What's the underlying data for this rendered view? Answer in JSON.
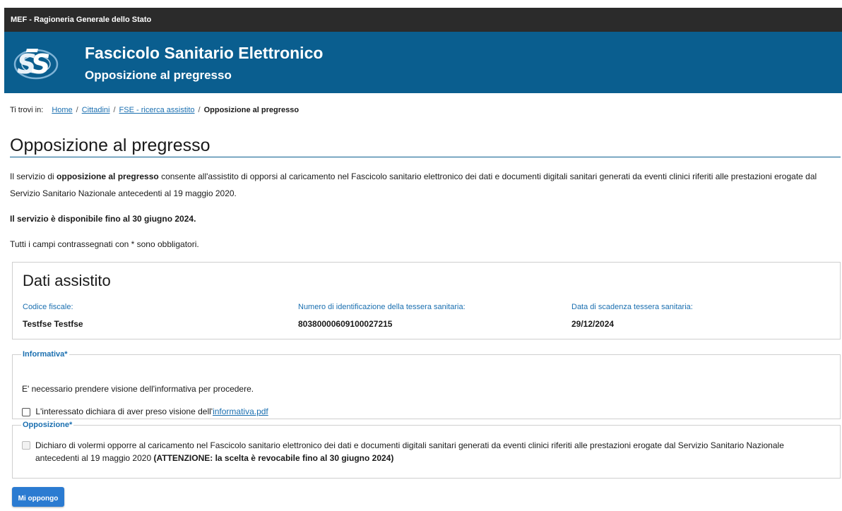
{
  "topbar": {
    "text": "MEF - Ragioneria Generale dello Stato"
  },
  "header": {
    "logo_text": "STS",
    "title": "Fascicolo Sanitario Elettronico",
    "subtitle": "Opposizione al pregresso"
  },
  "breadcrumb": {
    "label": "Ti trovi in:",
    "items": [
      "Home",
      "Cittadini",
      "FSE - ricerca assistito"
    ],
    "separator": "/",
    "current": "Opposizione al pregresso"
  },
  "page": {
    "title": "Opposizione al pregresso",
    "intro_before": "Il servizio di ",
    "intro_bold": "opposizione al pregresso",
    "intro_after": " consente all'assistito di opporsi al caricamento nel Fascicolo sanitario elettronico dei dati e documenti digitali sanitari generati da eventi clinici riferiti alle prestazioni erogate dal Servizio Sanitario Nazionale antecedenti al 19 maggio 2020.",
    "availability": "Il servizio è disponibile fino al 30 giugno 2024.",
    "required_note": "Tutti i campi contrassegnati con * sono obbligatori."
  },
  "patient": {
    "heading": "Dati assistito",
    "fields": [
      {
        "label": "Codice fiscale:",
        "value": "Testfse Testfse"
      },
      {
        "label": "Numero di identificazione della tessera sanitaria:",
        "value": "80380000609100027215"
      },
      {
        "label": "Data di scadenza tessera sanitaria:",
        "value": "29/12/2024"
      }
    ]
  },
  "informativa": {
    "legend": "Informativa*",
    "message": "E' necessario prendere visione dell'informativa per procedere.",
    "checkbox_text": "L'interessato dichiara di aver preso visione dell'",
    "link": "informativa.pdf",
    "checked": false
  },
  "opposizione": {
    "legend": "Opposizione*",
    "checkbox_text": "Dichiaro di volermi opporre al caricamento nel Fascicolo sanitario elettronico dei dati e documenti digitali sanitari generati da eventi clinici riferiti alle prestazioni erogate dal Servizio Sanitario Nazionale antecedenti al 19 maggio 2020 ",
    "checkbox_bold": "(ATTENZIONE: la scelta è revocabile fino al 30 giugno 2024)",
    "checked": false,
    "disabled": true
  },
  "actions": {
    "submit": "Mi oppongo"
  },
  "colors": {
    "topbar": "#2b2b2b",
    "header": "#0a5e8f",
    "link": "#1a6fb0",
    "button": "#2b7bd1"
  }
}
